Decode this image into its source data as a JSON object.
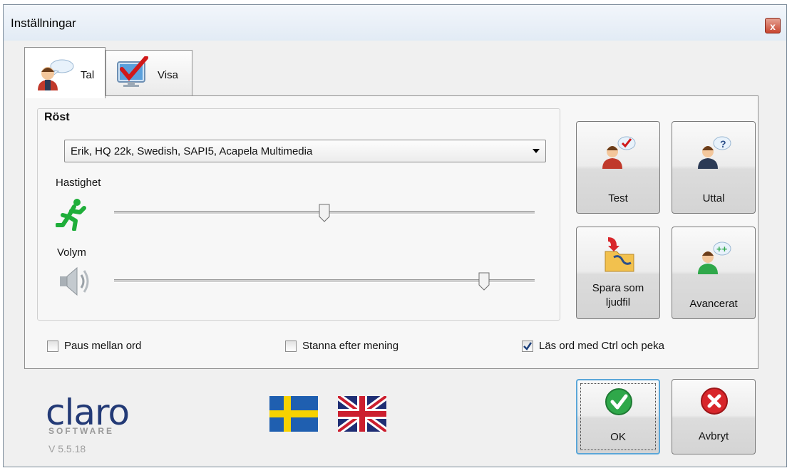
{
  "window": {
    "title": "Inställningar",
    "close_glyph": "x"
  },
  "tabs": [
    {
      "label": "Tal",
      "icon": "speaking-person-icon",
      "active": true
    },
    {
      "label": "Visa",
      "icon": "monitor-check-icon",
      "active": false
    }
  ],
  "voice": {
    "group_title": "Röst",
    "selected": "Erik, HQ 22k, Swedish, SAPI5, Acapela Multimedia",
    "speed_label": "Hastighet",
    "speed_value": 0.5,
    "volume_label": "Volym",
    "volume_value": 0.88
  },
  "action_buttons": {
    "test": "Test",
    "pronunciation": "Uttal",
    "save_line1": "Spara som",
    "save_line2": "ljudfil",
    "advanced": "Avancerat"
  },
  "options": [
    {
      "label": "Paus mellan ord",
      "checked": false
    },
    {
      "label": "Stanna efter mening",
      "checked": false
    },
    {
      "label": "Läs ord med Ctrl och peka",
      "checked": true
    }
  ],
  "footer": {
    "logo_text": "claro",
    "logo_sub": "SOFTWARE",
    "version": "V 5.5.18",
    "ok_label": "OK",
    "cancel_label": "Avbryt"
  },
  "colors": {
    "accent_green": "#2fa84a",
    "cancel_red": "#d8262b",
    "logo_blue": "#233a76"
  }
}
